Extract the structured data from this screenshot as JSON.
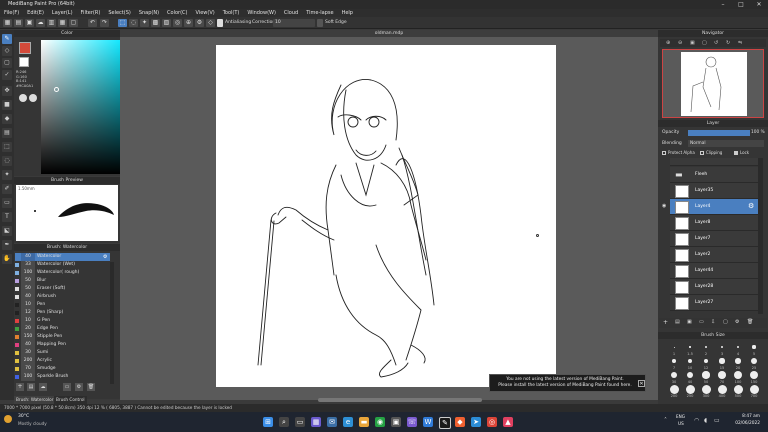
{
  "window": {
    "title": "MediBang Paint Pro (64bit)",
    "controls": [
      "–",
      "□",
      "✕"
    ]
  },
  "menu": [
    "File(F)",
    "Edit(E)",
    "Layer(L)",
    "Filter(R)",
    "Select(S)",
    "Snap(N)",
    "Color(C)",
    "View(V)",
    "Tool(T)",
    "Window(W)",
    "Cloud",
    "Time-lapse",
    "Help"
  ],
  "toolbar": {
    "antialiasing_label": "Antialiasing",
    "correction_label": "Correction",
    "correction_value": "10",
    "soft_edge_label": "Soft Edge"
  },
  "color_panel": {
    "title": "Color",
    "readout": [
      "R:246",
      "G:160",
      "B:141"
    ],
    "hex": "#9CA0A1",
    "fg": "#d44a3a",
    "bg": "#ffffff"
  },
  "brush_preview": {
    "title": "Brush Preview",
    "size": "1.50mm"
  },
  "brush_panel": {
    "title": "Brush: Watercolor",
    "items": [
      {
        "num": "40",
        "name": "Watercolor",
        "color": "#4a7fc0",
        "selected": true
      },
      {
        "num": "33",
        "name": "Watercolor (Wet)",
        "color": "#7fb0e0"
      },
      {
        "num": "100",
        "name": "Watercolor( rough)",
        "color": "#7fb0e0"
      },
      {
        "num": "50",
        "name": "Blur",
        "color": "#b9a0e0"
      },
      {
        "num": "50",
        "name": "Eraser (Soft)",
        "color": "#e0e0e0"
      },
      {
        "num": "40",
        "name": "Airbrush",
        "color": "#e0e0e0"
      },
      {
        "num": "10",
        "name": "Pen",
        "color": "#222222"
      },
      {
        "num": "12",
        "name": "Pen (Sharp)",
        "color": "#222222"
      },
      {
        "num": "10",
        "name": "G Pen",
        "color": "#e04040"
      },
      {
        "num": "20",
        "name": "Edge Pen",
        "color": "#40a040"
      },
      {
        "num": "150",
        "name": "Stipple Pen",
        "color": "#e08030"
      },
      {
        "num": "40",
        "name": "Mapping Pen",
        "color": "#e04080"
      },
      {
        "num": "30",
        "name": "Sumi",
        "color": "#e0c040"
      },
      {
        "num": "200",
        "name": "Acrylic",
        "color": "#e0c040"
      },
      {
        "num": "70",
        "name": "Smudge",
        "color": "#e0c040"
      },
      {
        "num": "100",
        "name": "Sparkle Brush",
        "color": "#4060e0"
      }
    ],
    "tabs": [
      "Brush: Watercolor",
      "Brush Control"
    ]
  },
  "document": {
    "tab": "oldman.mdp"
  },
  "navigator": {
    "title": "Navigator"
  },
  "layer_panel": {
    "title": "Layer",
    "opacity_label": "Opacity",
    "opacity_value": "100 %",
    "blending_label": "Blending",
    "blending_value": "Normal",
    "protect_alpha": "Protect Alpha",
    "clipping": "Clipping",
    "lock": "Lock",
    "layers": [
      {
        "name": "Fleeh",
        "selected": false
      },
      {
        "name": "Layer35",
        "selected": false
      },
      {
        "name": "Layer4",
        "selected": true
      },
      {
        "name": "Layer8",
        "selected": false
      },
      {
        "name": "Layer7",
        "selected": false
      },
      {
        "name": "Layer2",
        "selected": false
      },
      {
        "name": "Layer44",
        "selected": false
      },
      {
        "name": "Layer28",
        "selected": false
      },
      {
        "name": "Layer27",
        "selected": false
      }
    ]
  },
  "brush_size": {
    "title": "Brush Size",
    "sizes": [
      "1",
      "1.5",
      "2",
      "3",
      "4",
      "5",
      "7",
      "10",
      "12",
      "15",
      "20",
      "25",
      "30",
      "40",
      "50",
      "70",
      "100",
      "150",
      "200",
      "250",
      "300",
      "400",
      "500",
      "700"
    ]
  },
  "notification": {
    "line1": "You are not using the latest version of MediBang Paint.",
    "line2": "Please install the latest version of MediBang Paint found here."
  },
  "status": "7000 * 7000 pixel  (50.8 * 50.8cm)  350 dpi  12 %  ( 6805, 3887 )  Cannot be edited because the layer is locked",
  "taskbar": {
    "weather_temp": "30°C",
    "weather_desc": "Mostly cloudy",
    "lang1": "ENG",
    "lang2": "US",
    "time": "8:47 am",
    "date": "02/06/2022"
  }
}
